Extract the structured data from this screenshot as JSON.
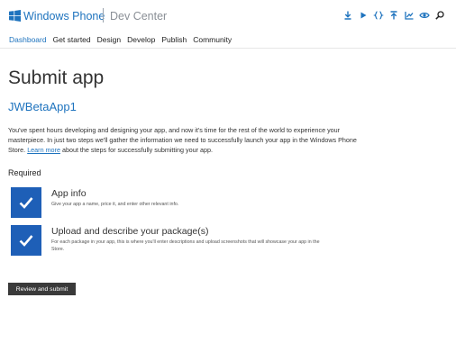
{
  "header": {
    "brand": "Windows Phone",
    "sub": "Dev Center",
    "logo_color": "#1e73be",
    "tool_icons": [
      "download-icon",
      "play-icon",
      "code-braces-icon",
      "upload-icon",
      "chart-icon",
      "eye-icon",
      "search-icon"
    ]
  },
  "nav": {
    "items": [
      {
        "label": "Dashboard",
        "active": true
      },
      {
        "label": "Get started",
        "active": false
      },
      {
        "label": "Design",
        "active": false
      },
      {
        "label": "Develop",
        "active": false
      },
      {
        "label": "Publish",
        "active": false
      },
      {
        "label": "Community",
        "active": false
      }
    ]
  },
  "page": {
    "title": "Submit app",
    "app_name": "JWBetaApp1",
    "intro_before": "You've spent hours developing and designing your app, and now it's time for the rest of the world to experience your masterpiece. In just two steps we'll gather the information we need to successfully launch your app in the Windows Phone Store. ",
    "intro_link": "Learn more",
    "intro_after": " about the steps for successfully submitting your app.",
    "section_label": "Required",
    "steps": [
      {
        "title": "App info",
        "description": "Give your app a name, price it, and enter other relevant info.",
        "completed": true
      },
      {
        "title": "Upload and describe your package(s)",
        "description": "For each package in your app, this is where you'll enter descriptions and upload screenshots that will showcase your app in the Store.",
        "completed": true
      }
    ],
    "submit_label": "Review and submit"
  },
  "colors": {
    "accent": "#1e73be",
    "check_tile": "#1e5fb7",
    "button": "#3a3a3a"
  }
}
